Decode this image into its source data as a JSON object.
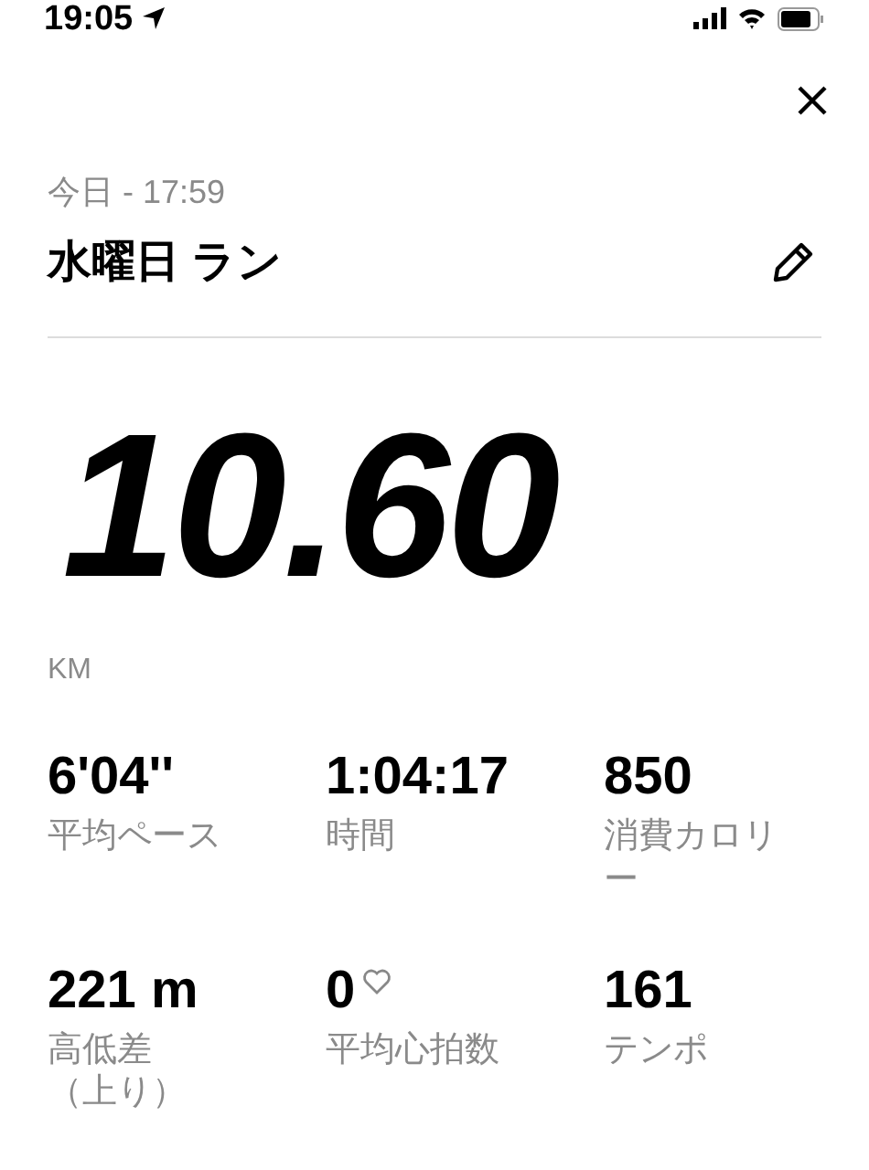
{
  "status_bar": {
    "time": "19:05"
  },
  "header": {
    "date": "今日 - 17:59",
    "title": "水曜日 ラン"
  },
  "distance": {
    "value": "10.60",
    "unit": "KM"
  },
  "stats": [
    {
      "value": "6'04''",
      "label": "平均ペース"
    },
    {
      "value": "1:04:17",
      "label": "時間"
    },
    {
      "value": "850",
      "label": "消費カロリー"
    },
    {
      "value": "221 m",
      "label": "高低差（上り）"
    },
    {
      "value": "0",
      "label": "平均心拍数",
      "kind": "heart"
    },
    {
      "value": "161",
      "label": "テンポ"
    }
  ]
}
